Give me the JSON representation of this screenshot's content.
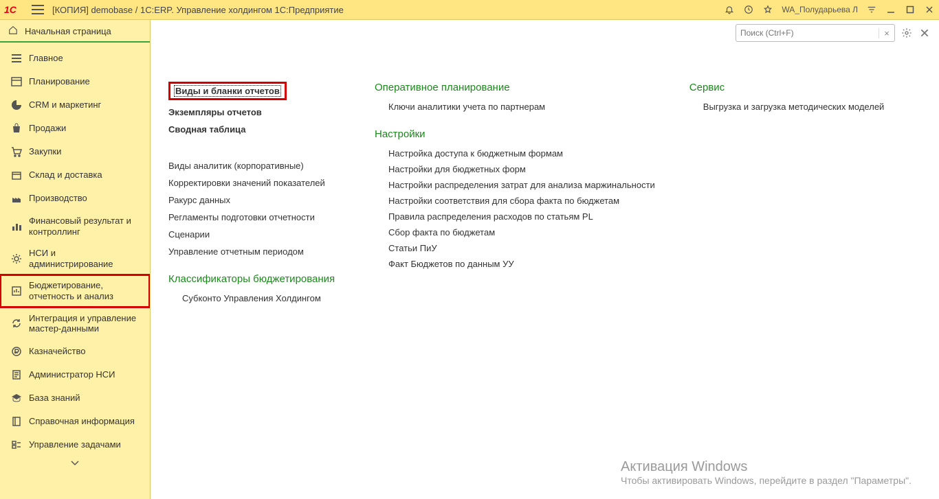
{
  "titlebar": {
    "title": "[КОПИЯ] demobase / 1С:ERP. Управление холдингом 1С:Предприятие",
    "user": "WA_Полударьева Л"
  },
  "home_label": "Начальная страница",
  "nav": [
    {
      "label": "Главное"
    },
    {
      "label": "Планирование"
    },
    {
      "label": "CRM и маркетинг"
    },
    {
      "label": "Продажи"
    },
    {
      "label": "Закупки"
    },
    {
      "label": "Склад и доставка"
    },
    {
      "label": "Производство"
    },
    {
      "label": "Финансовый результат и контроллинг"
    },
    {
      "label": "НСИ и администрирование"
    },
    {
      "label": "Бюджетирование, отчетность и анализ"
    },
    {
      "label": "Интеграция и управление мастер-данными"
    },
    {
      "label": "Казначейство"
    },
    {
      "label": "Администратор НСИ"
    },
    {
      "label": "База знаний"
    },
    {
      "label": "Справочная информация"
    },
    {
      "label": "Управление задачами"
    }
  ],
  "search": {
    "placeholder": "Поиск (Ctrl+F)",
    "clear": "×"
  },
  "col1": {
    "bold": [
      "Виды и бланки отчетов",
      "Экземпляры отчетов",
      "Сводная таблица"
    ],
    "list1": [
      "Виды аналитик (корпоративные)",
      "Корректировки значений показателей",
      "Ракурс данных",
      "Регламенты подготовки отчетности",
      "Сценарии",
      "Управление отчетным периодом"
    ],
    "head2": "Классификаторы бюджетирования",
    "list2": [
      "Субконто Управления Холдингом"
    ]
  },
  "col2": {
    "head1": "Оперативное планирование",
    "list1": [
      "Ключи аналитики учета по партнерам"
    ],
    "head2": "Настройки",
    "list2": [
      "Настройка доступа к бюджетным формам",
      "Настройки для бюджетных форм",
      "Настройки распределения затрат для анализа маржинальности",
      "Настройки соответствия для сбора факта по бюджетам",
      "Правила распределения расходов по статьям PL",
      "Сбор факта по бюджетам",
      "Статьи ПиУ",
      "Факт Бюджетов по данным УУ"
    ]
  },
  "col3": {
    "head1": "Сервис",
    "list1": [
      "Выгрузка и загрузка методических моделей"
    ]
  },
  "watermark": {
    "line1": "Активация Windows",
    "line2": "Чтобы активировать Windows, перейдите в раздел \"Параметры\"."
  }
}
